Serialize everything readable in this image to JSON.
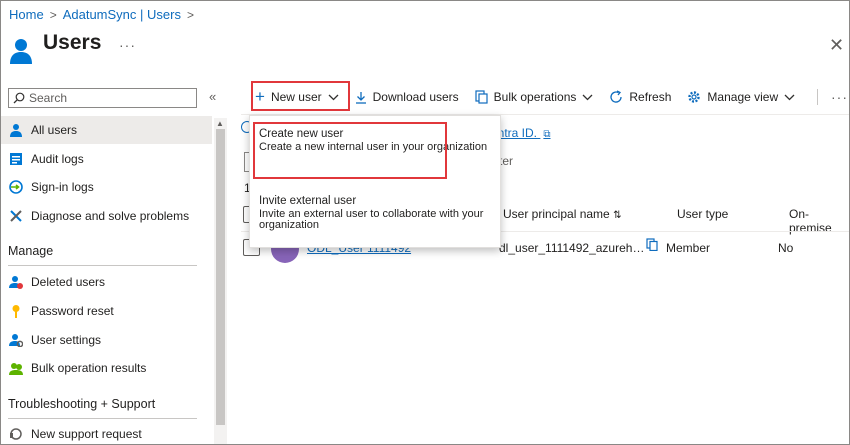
{
  "breadcrumb": {
    "home": "Home",
    "sync": "AdatumSync | Users",
    "separator": ">"
  },
  "header": {
    "title": "Users",
    "more": "···",
    "close": "✕"
  },
  "sidebar": {
    "search_placeholder": "Search",
    "collapse": "«",
    "items": [
      {
        "label": "All users",
        "icon": "user-icon"
      },
      {
        "label": "Audit logs",
        "icon": "log-icon"
      },
      {
        "label": "Sign-in logs",
        "icon": "signin-icon"
      },
      {
        "label": "Diagnose and solve problems",
        "icon": "wrench-icon"
      }
    ],
    "manage_heading": "Manage",
    "manage_items": [
      {
        "label": "Deleted users",
        "icon": "deleted-user-icon"
      },
      {
        "label": "Password reset",
        "icon": "key-icon"
      },
      {
        "label": "User settings",
        "icon": "user-settings-icon"
      },
      {
        "label": "Bulk operation results",
        "icon": "bulk-results-icon"
      }
    ],
    "support_heading": "Troubleshooting + Support",
    "support_items": [
      {
        "label": "New support request",
        "icon": "support-icon"
      }
    ]
  },
  "toolbar": {
    "new_user": "New user",
    "download_users": "Download users",
    "bulk_operations": "Bulk operations",
    "refresh": "Refresh",
    "manage_view": "Manage view",
    "more": "···"
  },
  "dropdown": {
    "create_title": "Create new user",
    "create_desc": "Create a new internal user in your organization",
    "invite_title": "Invite external user",
    "invite_desc": "Invite an external user to collaborate with your organization"
  },
  "content": {
    "entra_link": "t Entra ID.",
    "filter_text": "ter",
    "count": "1",
    "columns": {
      "upn": "User principal name",
      "user_type": "User type",
      "on_premises": "On-premise"
    },
    "row": {
      "name": "ODL_User 1111492",
      "upn": "dl_user_1111492_azureh…",
      "user_type": "Member",
      "on_premises": "No"
    }
  },
  "colors": {
    "accent": "#0f6cbd",
    "highlight": "#e1373b",
    "selected": "#edebe9"
  }
}
